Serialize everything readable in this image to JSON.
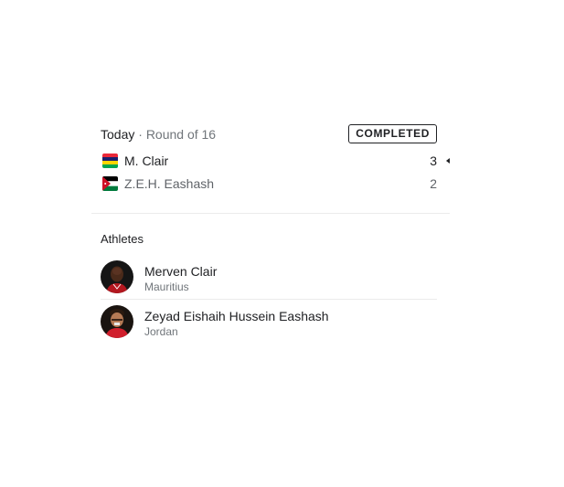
{
  "match": {
    "day": "Today",
    "separator": "·",
    "round": "Round of 16",
    "status": "COMPLETED",
    "competitors": [
      {
        "name": "M. Clair",
        "score": "3",
        "flag_icon": "mauritius-flag-icon",
        "winner": true
      },
      {
        "name": "Z.E.H. Eashash",
        "score": "2",
        "flag_icon": "jordan-flag-icon",
        "winner": false
      }
    ]
  },
  "athletes": {
    "title": "Athletes",
    "items": [
      {
        "name": "Merven Clair",
        "country": "Mauritius"
      },
      {
        "name": "Zeyad Eishaih Hussein Eashash",
        "country": "Jordan"
      }
    ]
  },
  "colors": {
    "text_primary": "#202124",
    "text_secondary": "#70757a",
    "divider": "#ebebeb"
  }
}
